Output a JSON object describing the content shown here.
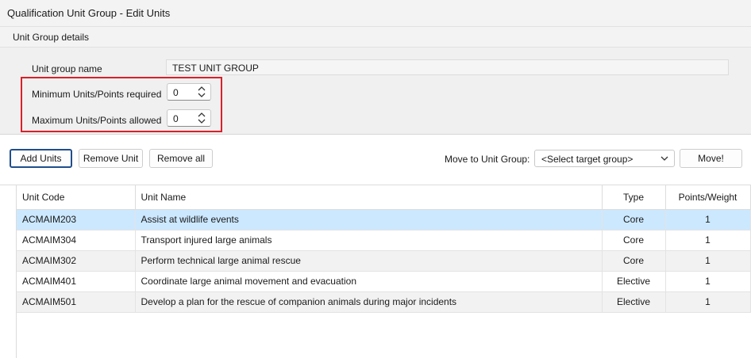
{
  "window": {
    "title": "Qualification Unit Group - Edit Units"
  },
  "details": {
    "section_title": "Unit Group details",
    "name_label": "Unit group name",
    "name_value": "TEST UNIT GROUP",
    "min_label": "Minimum Units/Points required",
    "min_value": "0",
    "max_label": "Maximum Units/Points allowed",
    "max_value": "0"
  },
  "toolbar": {
    "add_units": "Add Units",
    "remove_unit": "Remove Unit",
    "remove_all": "Remove all",
    "move_label": "Move to Unit Group:",
    "move_select": "<Select target group>",
    "move_button": "Move!"
  },
  "table": {
    "columns": [
      "Unit Code",
      "Unit Name",
      "Type",
      "Points/Weight"
    ],
    "rows": [
      {
        "code": "ACMAIM203",
        "name": "Assist at wildlife events",
        "type": "Core",
        "points": "1"
      },
      {
        "code": "ACMAIM304",
        "name": "Transport injured large animals",
        "type": "Core",
        "points": "1"
      },
      {
        "code": "ACMAIM302",
        "name": "Perform technical large animal rescue",
        "type": "Core",
        "points": "1"
      },
      {
        "code": "ACMAIM401",
        "name": "Coordinate large animal movement and evacuation",
        "type": "Elective",
        "points": "1"
      },
      {
        "code": "ACMAIM501",
        "name": "Develop a plan for the rescue of companion animals during major incidents",
        "type": "Elective",
        "points": "1"
      }
    ]
  },
  "colors": {
    "accent": "#1f4e8c",
    "selection": "#cce8ff",
    "highlight_box": "#d8202a"
  }
}
